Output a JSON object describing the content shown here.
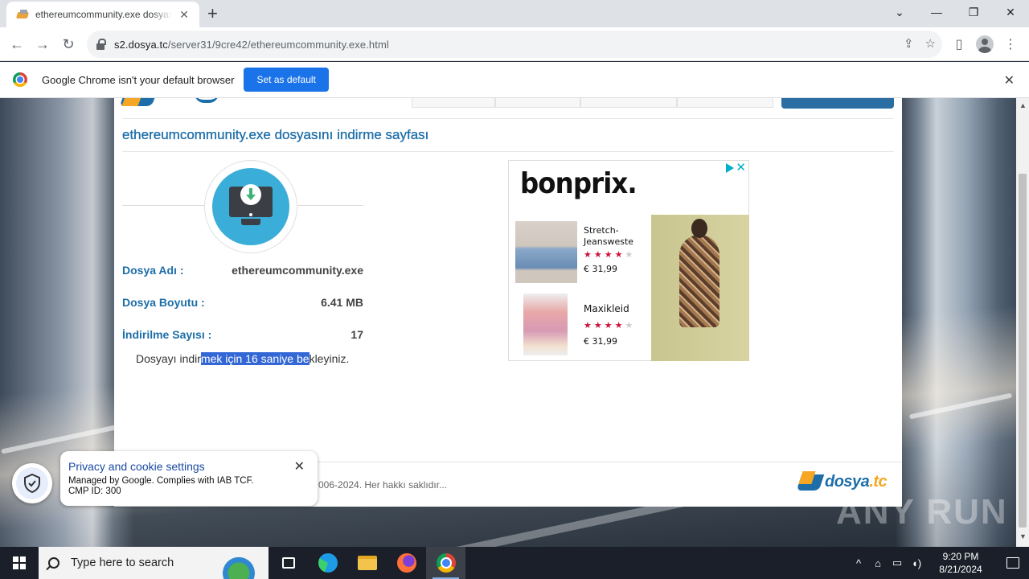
{
  "browser": {
    "tab_title": "ethereumcommunity.exe dosyası",
    "new_tab": "+",
    "url_host": "s2.dosya.tc",
    "url_path": "/server31/9cre42/ethereumcommunity.exe.html",
    "infobar_text": "Google Chrome isn't your default browser",
    "set_default_label": "Set as default"
  },
  "page": {
    "title": "ethereumcommunity.exe dosyasını indirme sayfası",
    "fields": [
      {
        "label": "Dosya Adı :",
        "value": "ethereumcommunity.exe"
      },
      {
        "label": "Dosya Boyutu :",
        "value": "6.41 MB"
      },
      {
        "label": "İndirilme Sayısı :",
        "value": "17"
      }
    ],
    "wait_before": "Dosyayı indir",
    "wait_selected": "mek için 16 saniye be",
    "wait_after": "kleyiniz.",
    "copyright": "006-2024. Her hakkı saklıdır...",
    "footer_logo_main": "dosya",
    "footer_logo_tld": ".tc"
  },
  "ad": {
    "brand": "bonprix.",
    "products": [
      {
        "name": "Stretch-Jeansweste",
        "rating": 4,
        "price": "€ 31,99"
      },
      {
        "name": "Maxikleid",
        "rating": 4,
        "price": "€ 31,99"
      }
    ],
    "accent_color": "#00aecd"
  },
  "privacy": {
    "title": "Privacy and cookie settings",
    "line1": "Managed by Google. Complies with IAB TCF.",
    "line2": "CMP ID: 300"
  },
  "watermark": "ANY RUN",
  "taskbar": {
    "search_placeholder": "Type here to search",
    "time": "9:20 PM",
    "date": "8/21/2024"
  },
  "colors": {
    "brand_blue": "#1d6ea8",
    "brand_orange": "#f5a623",
    "selection": "#3367d6",
    "chrome_button": "#1a73e8"
  }
}
